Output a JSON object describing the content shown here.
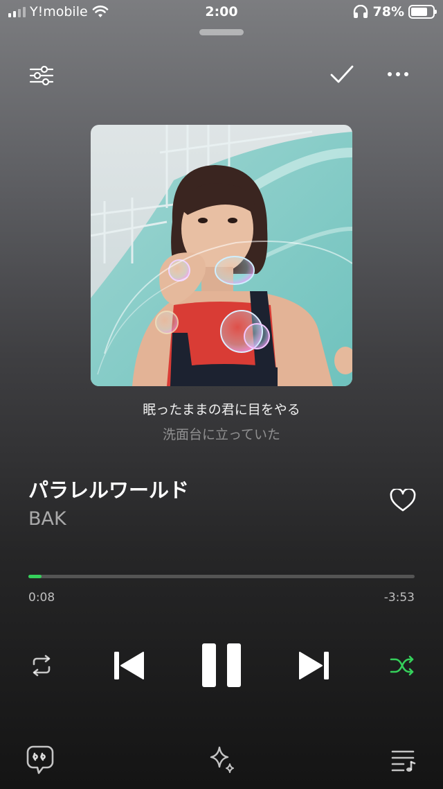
{
  "status_bar": {
    "carrier": "Y!mobile",
    "time": "2:00",
    "battery_percent": "78%",
    "battery_level": 0.78
  },
  "icons": {
    "equalizer": "sliders-icon",
    "check": "check-icon",
    "more": "more-icon",
    "heart": "heart-icon",
    "repeat": "repeat-icon",
    "previous": "previous-icon",
    "pause": "pause-icon",
    "next": "next-icon",
    "shuffle": "shuffle-icon",
    "lyrics": "lyrics-icon",
    "sparkle": "sparkle-icon",
    "queue": "queue-icon"
  },
  "lyrics": {
    "current": "眠ったままの君に目をやる",
    "next": "洗面台に立っていた"
  },
  "track": {
    "title": "パラレルワールド",
    "artist": "BAK"
  },
  "playback": {
    "elapsed": "0:08",
    "remaining": "-3:53",
    "progress": 0.034
  },
  "colors": {
    "accent": "#35d05b"
  }
}
